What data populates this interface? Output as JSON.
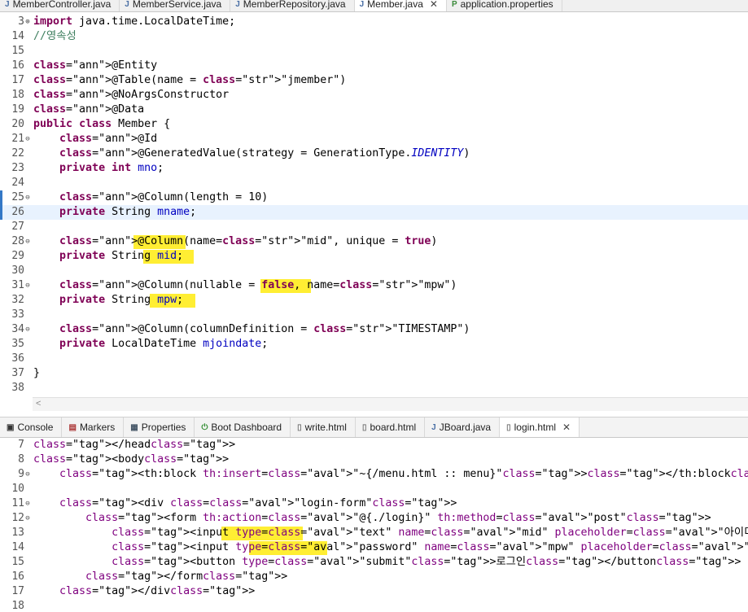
{
  "editor_tabs": [
    {
      "label": "MemberController.java",
      "icon": "java-file-icon"
    },
    {
      "label": "MemberService.java",
      "icon": "java-file-icon"
    },
    {
      "label": "MemberRepository.java",
      "icon": "java-file-icon"
    },
    {
      "label": "Member.java",
      "icon": "java-file-icon",
      "active": true
    },
    {
      "label": "application.properties",
      "icon": "properties-file-icon"
    }
  ],
  "panel_tabs": [
    {
      "label": "Console",
      "icon": "console-icon"
    },
    {
      "label": "Markers",
      "icon": "markers-icon"
    },
    {
      "label": "Properties",
      "icon": "properties-icon"
    },
    {
      "label": "Boot Dashboard",
      "icon": "boot-dashboard-icon"
    },
    {
      "label": "write.html",
      "icon": "html-file-icon"
    },
    {
      "label": "board.html",
      "icon": "html-file-icon"
    },
    {
      "label": "JBoard.java",
      "icon": "java-file-icon"
    },
    {
      "label": "login.html",
      "icon": "html-file-icon",
      "active": true
    }
  ],
  "java_lines": [
    {
      "n": "3",
      "t": "import java.time.LocalDateTime;"
    },
    {
      "n": "14",
      "t": "//영속성"
    },
    {
      "n": "15",
      "t": ""
    },
    {
      "n": "16",
      "t": "@Entity"
    },
    {
      "n": "17",
      "t": "@Table(name = \"jmember\")"
    },
    {
      "n": "18",
      "t": "@NoArgsConstructor"
    },
    {
      "n": "19",
      "t": "@Data"
    },
    {
      "n": "20",
      "t": "public class Member {"
    },
    {
      "n": "21",
      "t": "    @Id"
    },
    {
      "n": "22",
      "t": "    @GeneratedValue(strategy = GenerationType.IDENTITY)"
    },
    {
      "n": "23",
      "t": "    private int mno;"
    },
    {
      "n": "24",
      "t": ""
    },
    {
      "n": "25",
      "t": "    @Column(length = 10)"
    },
    {
      "n": "26",
      "t": "    private String mname;"
    },
    {
      "n": "27",
      "t": ""
    },
    {
      "n": "28",
      "t": "    @Column(name=\"mid\", unique = true)"
    },
    {
      "n": "29",
      "t": "    private String mid;"
    },
    {
      "n": "30",
      "t": ""
    },
    {
      "n": "31",
      "t": "    @Column(nullable = false, name=\"mpw\")"
    },
    {
      "n": "32",
      "t": "    private String mpw;"
    },
    {
      "n": "33",
      "t": ""
    },
    {
      "n": "34",
      "t": "    @Column(columnDefinition = \"TIMESTAMP\")"
    },
    {
      "n": "35",
      "t": "    private LocalDateTime mjoindate;"
    },
    {
      "n": "36",
      "t": ""
    },
    {
      "n": "37",
      "t": "}"
    },
    {
      "n": "38",
      "t": ""
    }
  ],
  "html_lines": [
    {
      "n": "7",
      "t": "</head>"
    },
    {
      "n": "8",
      "t": "<body>"
    },
    {
      "n": "9",
      "t": "    <th:block th:insert=\"~{/menu.html :: menu}\"></th:block>"
    },
    {
      "n": "10",
      "t": ""
    },
    {
      "n": "11",
      "t": "    <div class=\"login-form\">"
    },
    {
      "n": "12",
      "t": "        <form th:action=\"@{./login}\" th:method=\"post\">"
    },
    {
      "n": "13",
      "t": "            <input type=\"text\" name=\"mid\" placeholder=\"아이디를 입력하세요\" required=\"required\">"
    },
    {
      "n": "14",
      "t": "            <input type=\"password\" name=\"mpw\" placeholder=\"암호를 입력하세요\" required=\"required\">"
    },
    {
      "n": "15",
      "t": "            <button type=\"submit\">로그인</button>"
    },
    {
      "n": "16",
      "t": "        </form>"
    },
    {
      "n": "17",
      "t": "    </div>"
    },
    {
      "n": "18",
      "t": ""
    }
  ],
  "colors": {
    "keyword": "#7f0055",
    "string": "#2a00ff",
    "annotation": "#646464",
    "comment": "#3f7f5f",
    "field": "#0000c0",
    "highlight": "#ffea00"
  }
}
